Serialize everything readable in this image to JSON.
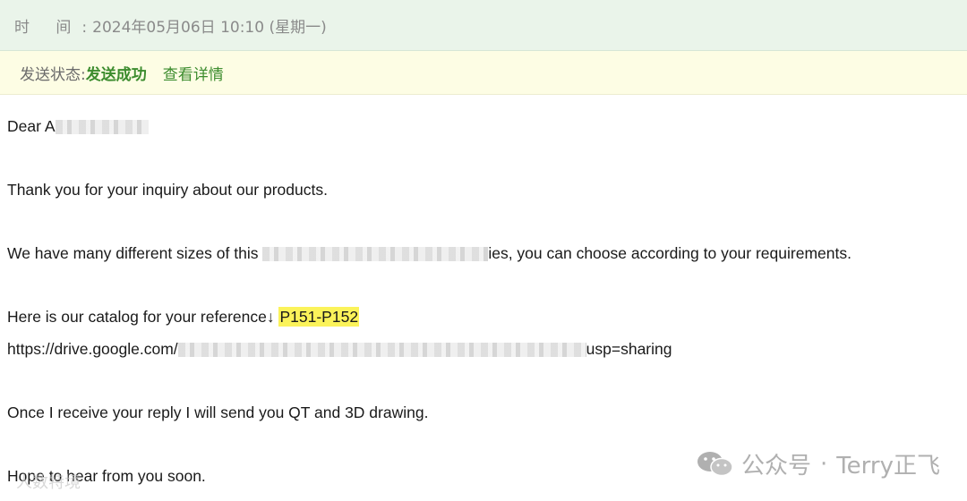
{
  "header": {
    "time_label": "时 间:",
    "time_value": "2024年05月06日 10:10 (星期一)"
  },
  "status": {
    "label": "发送状态:",
    "value": "发送成功",
    "details_link": "查看详情"
  },
  "email": {
    "greeting_prefix": "Dear A",
    "line_thanks": "Thank you for your inquiry about our products.",
    "line_sizes_prefix": "We have many different sizes of this ",
    "line_sizes_suffix": "ies, you can choose according to your requirements.",
    "line_catalog_prefix": "Here is our catalog for your reference↓ ",
    "catalog_pages": "P151-P152",
    "link_prefix": "https://drive.google.com/",
    "link_suffix": "usp=sharing",
    "line_reply": "Once I receive your reply I will send you QT and 3D drawing.",
    "line_closing": "Hope to hear from you soon."
  },
  "watermark": {
    "text": "公众号",
    "separator": "·",
    "author": "Terry正飞",
    "icon": "wechat-icon",
    "corner_text": "人数特境"
  }
}
